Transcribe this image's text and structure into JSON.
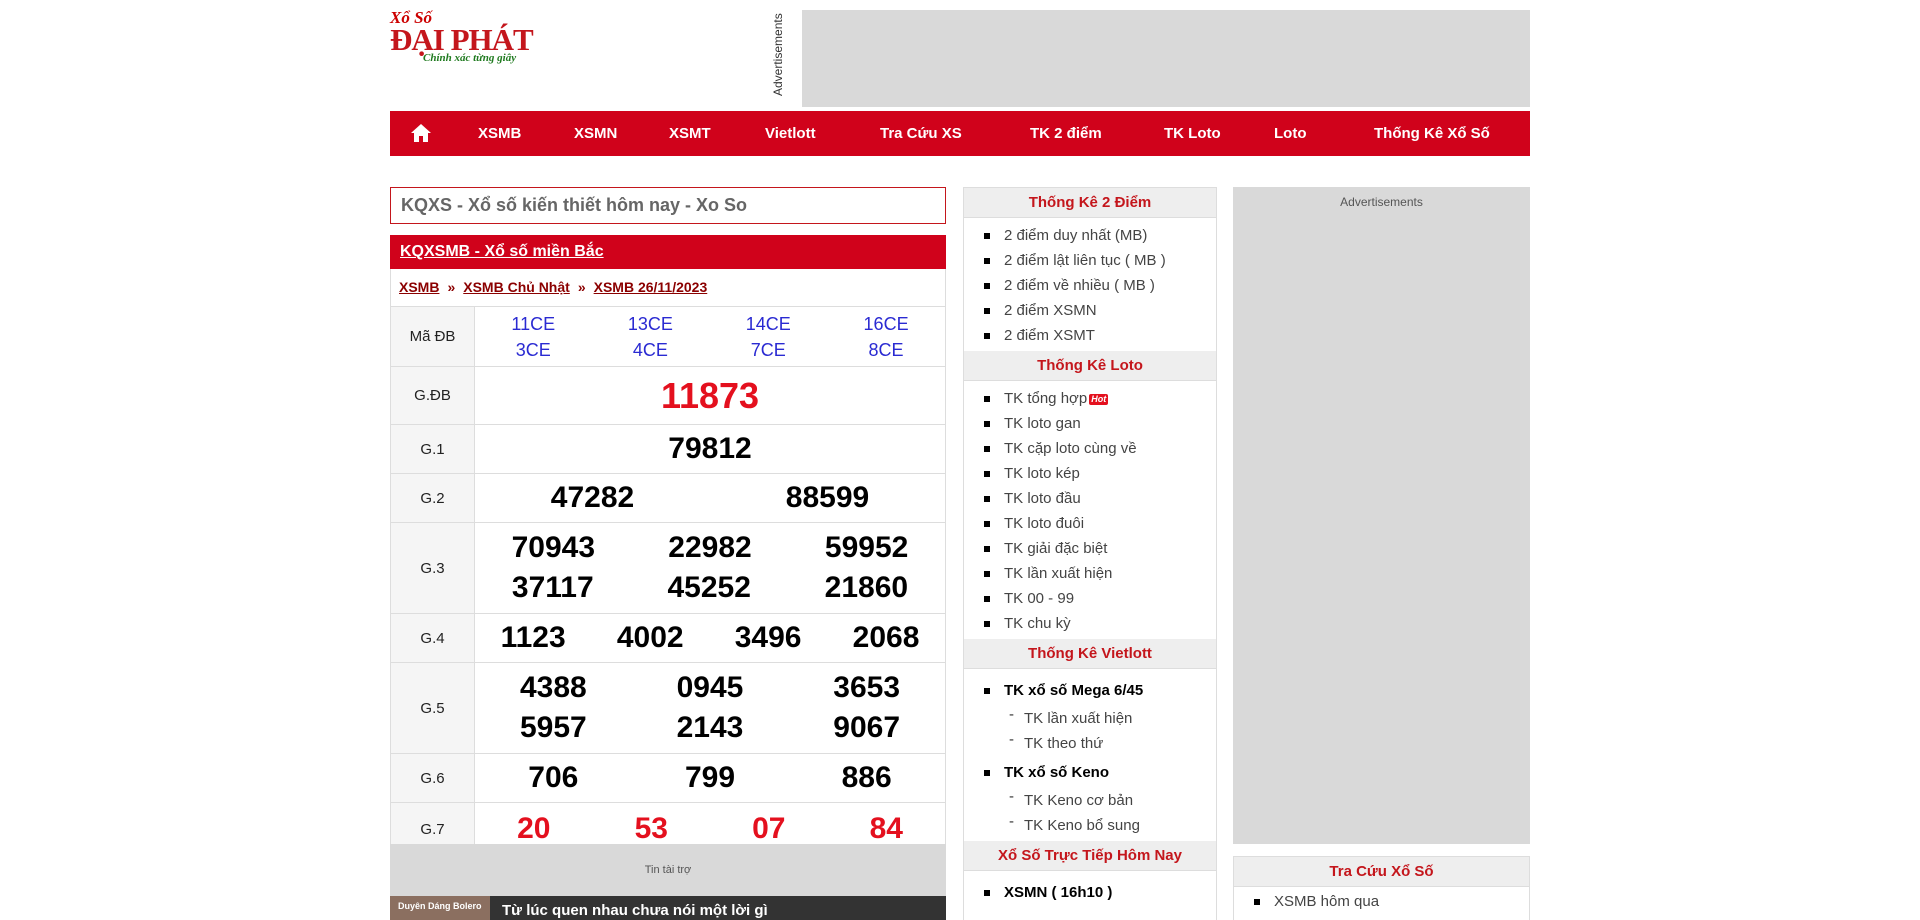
{
  "logo": {
    "small": "Xổ Số",
    "big": "ĐẠI PHÁT",
    "tagline": "Chính xác từng giây"
  },
  "ads": {
    "vertical_label": "Advertisements",
    "right_label": "Advertisements",
    "sponsor_label": "Tin tài trợ"
  },
  "nav": {
    "home_icon": "home-icon",
    "items": [
      "XSMB",
      "XSMN",
      "XSMT",
      "Vietlott",
      "Tra Cứu XS",
      "TK 2 điểm",
      "TK Loto",
      "Loto",
      "Thống Kê Xổ Số"
    ]
  },
  "search": {
    "text": "KQXS - Xổ số kiến thiết hôm nay - Xo So"
  },
  "results": {
    "title": "KQXSMB - Xổ số miền Bắc",
    "breadcrumb": [
      "XSMB",
      "XSMB Chủ Nhật",
      "XSMB 26/11/2023"
    ],
    "breadcrumb_sep": "»",
    "ma_db_label": "Mã ĐB",
    "ma_db": [
      [
        "11CE",
        "3CE"
      ],
      [
        "13CE",
        "4CE"
      ],
      [
        "14CE",
        "7CE"
      ],
      [
        "16CE",
        "8CE"
      ]
    ],
    "prizes": [
      {
        "label": "G.ĐB",
        "rows": [
          [
            "11873"
          ]
        ],
        "color": "#e4101e"
      },
      {
        "label": "G.1",
        "rows": [
          [
            "79812"
          ]
        ]
      },
      {
        "label": "G.2",
        "rows": [
          [
            "47282",
            "88599"
          ]
        ]
      },
      {
        "label": "G.3",
        "rows": [
          [
            "70943",
            "22982",
            "59952"
          ],
          [
            "37117",
            "45252",
            "21860"
          ]
        ]
      },
      {
        "label": "G.4",
        "rows": [
          [
            "1123",
            "4002",
            "3496",
            "2068"
          ]
        ]
      },
      {
        "label": "G.5",
        "rows": [
          [
            "4388",
            "0945",
            "3653"
          ],
          [
            "5957",
            "2143",
            "9067"
          ]
        ]
      },
      {
        "label": "G.6",
        "rows": [
          [
            "706",
            "799",
            "886"
          ]
        ]
      },
      {
        "label": "G.7",
        "rows": [
          [
            "20",
            "53",
            "07",
            "84"
          ]
        ],
        "color": "#e4101e"
      }
    ]
  },
  "video": {
    "thumb_text": "Duyên Dáng Bolero",
    "title": "Từ lúc quen nhau chưa nói một lời gì"
  },
  "sidebar": {
    "sections": [
      {
        "title": "Thống Kê 2 Điểm",
        "items": [
          {
            "label": "2 điểm duy nhất (MB)"
          },
          {
            "label": "2 điểm lật liên tục ( MB )"
          },
          {
            "label": "2 điểm về nhiều ( MB )"
          },
          {
            "label": "2 điểm XSMN"
          },
          {
            "label": "2 điểm XSMT"
          }
        ]
      },
      {
        "title": "Thống Kê Loto",
        "items": [
          {
            "label": "TK tổng hợp",
            "badge": "Hot"
          },
          {
            "label": "TK loto gan"
          },
          {
            "label": "TK cặp loto cùng về"
          },
          {
            "label": "TK loto kép"
          },
          {
            "label": "TK loto đầu"
          },
          {
            "label": "TK loto đuôi"
          },
          {
            "label": "TK giải đặc biệt"
          },
          {
            "label": "TK lần xuất hiện"
          },
          {
            "label": "TK 00 - 99"
          },
          {
            "label": "TK chu kỳ"
          }
        ]
      },
      {
        "title": "Thống Kê Vietlott",
        "items": [
          {
            "label": "TK xổ số Mega 6/45",
            "type": "bold"
          },
          {
            "label": "TK lần xuất hiện",
            "type": "sub"
          },
          {
            "label": "TK theo thứ",
            "type": "sub"
          },
          {
            "label": "TK xổ số Keno",
            "type": "bold"
          },
          {
            "label": "TK Keno cơ bản",
            "type": "sub"
          },
          {
            "label": "TK Keno bổ sung",
            "type": "sub"
          }
        ]
      },
      {
        "title": "Xổ Số Trực Tiếp Hôm Nay",
        "items": [
          {
            "label": "XSMN ( 16h10 )",
            "type": "bold"
          }
        ]
      }
    ]
  },
  "tracuu": {
    "title": "Tra Cứu Xổ Số",
    "items": [
      "XSMB hôm qua"
    ]
  }
}
